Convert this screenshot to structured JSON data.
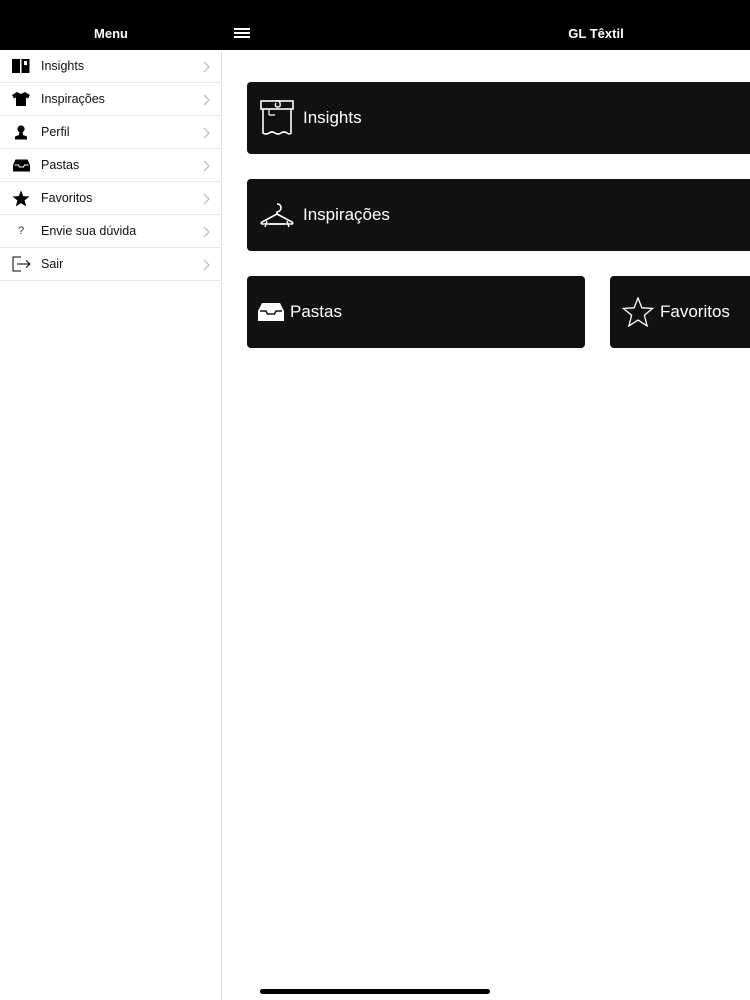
{
  "sidebar": {
    "title": "Menu",
    "items": [
      {
        "label": "Insights",
        "icon": "book-icon"
      },
      {
        "label": "Inspirações",
        "icon": "tshirt-icon"
      },
      {
        "label": "Perfil",
        "icon": "person-icon"
      },
      {
        "label": "Pastas",
        "icon": "inbox-icon"
      },
      {
        "label": "Favoritos",
        "icon": "star-icon"
      },
      {
        "label": "Envie sua dúvida",
        "icon": "question-icon",
        "glyph": "?"
      },
      {
        "label": "Sair",
        "icon": "logout-icon"
      }
    ]
  },
  "header": {
    "title": "GL Têxtil"
  },
  "cards": {
    "insights": {
      "label": "Insights",
      "icon": "fabric-tag-icon"
    },
    "inspiracoes": {
      "label": "Inspirações",
      "icon": "hanger-icon"
    },
    "pastas": {
      "label": "Pastas",
      "icon": "inbox-icon"
    },
    "favoritos": {
      "label": "Favoritos",
      "icon": "star-outline-icon"
    }
  },
  "colors": {
    "bar": "#000000",
    "card": "#111111",
    "text": "#ffffff",
    "divider": "#e6e6e6"
  }
}
